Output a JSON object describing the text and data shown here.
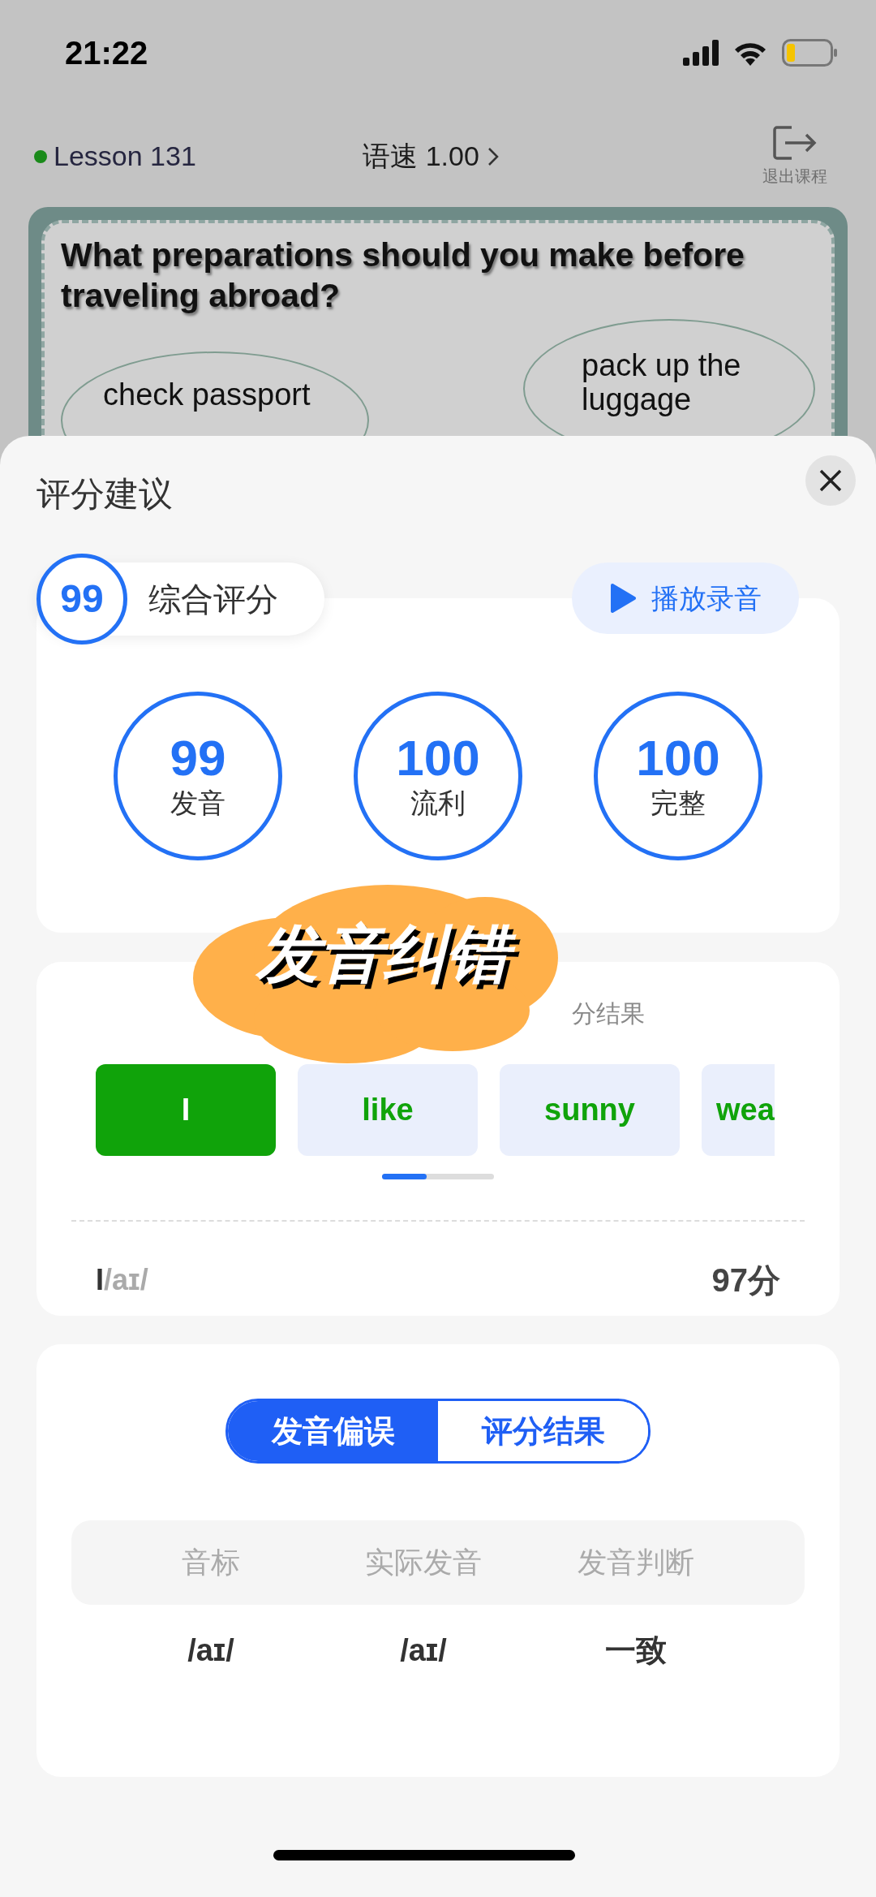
{
  "status_bar": {
    "time": "21:22"
  },
  "header": {
    "lesson": "Lesson 131",
    "speed": "语速 1.00",
    "exit_label": "退出课程"
  },
  "slide": {
    "question": "What preparations should you make before traveling abroad?",
    "bubbles": [
      "check passport",
      "pack up the luggage"
    ]
  },
  "sheet": {
    "title": "评分建议",
    "overall": {
      "score": "99",
      "label": "综合评分"
    },
    "play_button": "播放录音",
    "scores": [
      {
        "value": "99",
        "label": "发音"
      },
      {
        "value": "100",
        "label": "流利"
      },
      {
        "value": "100",
        "label": "完整"
      }
    ]
  },
  "words": {
    "hint": "分结果",
    "items": [
      {
        "text": "I",
        "selected": true,
        "cut": false,
        "color": "#10a30a"
      },
      {
        "text": "like",
        "selected": false,
        "cut": false,
        "color": "#10a30a"
      },
      {
        "text": "sunny",
        "selected": false,
        "cut": false,
        "color": "#10a30a"
      },
      {
        "text": "wea",
        "selected": false,
        "cut": true,
        "color": "#10a30a"
      }
    ]
  },
  "selected_word": {
    "word": "I",
    "phonetic": "/aɪ/",
    "score": "97分"
  },
  "tabs": [
    {
      "label": "发音偏误",
      "selected": true
    },
    {
      "label": "评分结果",
      "selected": false
    }
  ],
  "table": {
    "columns": [
      "音标",
      "实际发音",
      "发音判断"
    ],
    "rows": [
      [
        "/aɪ/",
        "/aɪ/",
        "一致"
      ]
    ]
  },
  "sticker": {
    "text": "发音纠错"
  }
}
